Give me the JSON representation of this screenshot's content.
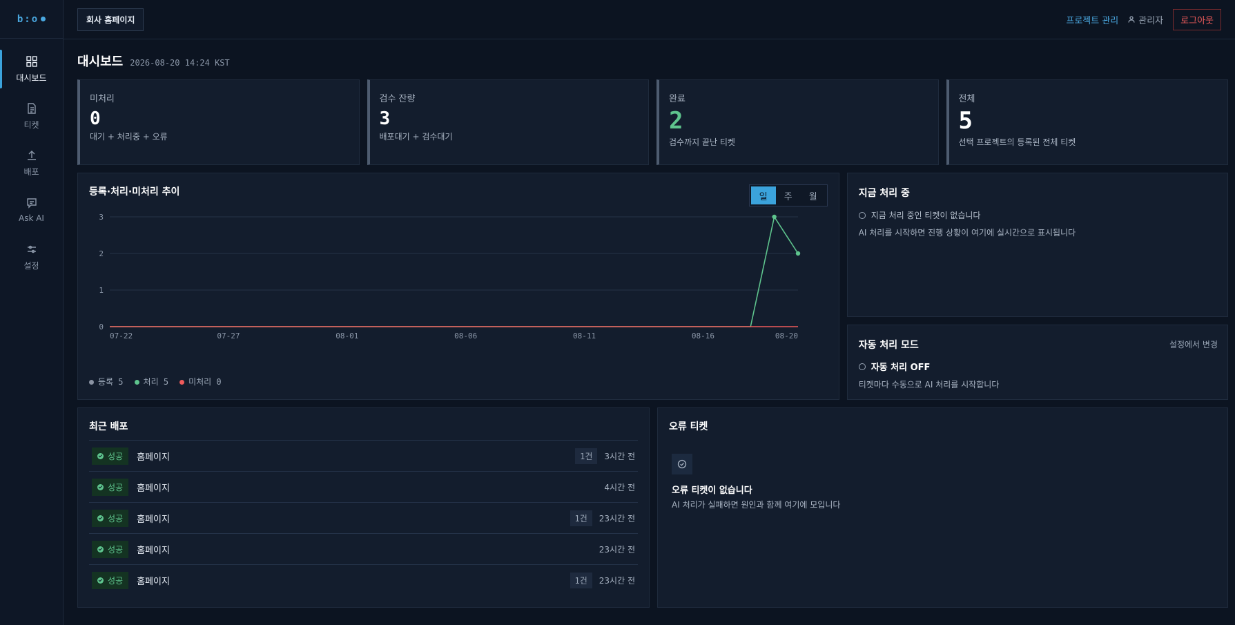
{
  "sidebar": {
    "logo": "b:o",
    "items": [
      {
        "label": "대시보드",
        "icon": "dashboard-icon"
      },
      {
        "label": "티켓",
        "icon": "document-icon"
      },
      {
        "label": "배포",
        "icon": "upload-icon"
      },
      {
        "label": "Ask AI",
        "icon": "chat-icon"
      },
      {
        "label": "설정",
        "icon": "sliders-icon"
      }
    ]
  },
  "topbar": {
    "project": "회사 홈페이지",
    "manage_projects": "프로젝트 관리",
    "user": "관리자",
    "logout": "로그아웃"
  },
  "page": {
    "title": "대시보드",
    "timestamp": "2026-08-20 14:24 KST"
  },
  "stats": [
    {
      "label": "미처리",
      "value": "0",
      "sub": "대기 + 처리중 + 오류"
    },
    {
      "label": "검수 잔량",
      "value": "3",
      "sub": "배포대기 + 검수대기"
    },
    {
      "label": "완료",
      "value": "2",
      "sub": "검수까지 끝난 티켓"
    },
    {
      "label": "전체",
      "value": "5",
      "sub": "선택 프로젝트의 등록된 전체 티켓"
    }
  ],
  "chart": {
    "title": "등록·처리·미처리 추이",
    "periods": [
      "일",
      "주",
      "월"
    ],
    "active_period": "일",
    "legend": [
      {
        "label": "등록 5",
        "color": "#8a93a3"
      },
      {
        "label": "처리 5",
        "color": "#5ec48d"
      },
      {
        "label": "미처리 0",
        "color": "#ef5b5b"
      }
    ]
  },
  "chart_data": {
    "type": "line",
    "x": [
      "07-22",
      "07-23",
      "07-24",
      "07-25",
      "07-26",
      "07-27",
      "07-28",
      "07-29",
      "07-30",
      "07-31",
      "08-01",
      "08-02",
      "08-03",
      "08-04",
      "08-05",
      "08-06",
      "08-07",
      "08-08",
      "08-09",
      "08-10",
      "08-11",
      "08-12",
      "08-13",
      "08-14",
      "08-15",
      "08-16",
      "08-17",
      "08-18",
      "08-19",
      "08-20"
    ],
    "xticks": [
      "07-22",
      "07-27",
      "08-01",
      "08-06",
      "08-11",
      "08-16",
      "08-20"
    ],
    "yticks": [
      0,
      1,
      2,
      3
    ],
    "ylim": [
      0,
      3
    ],
    "grid": true,
    "series": [
      {
        "name": "처리",
        "color": "#5ec48d",
        "values": [
          0,
          0,
          0,
          0,
          0,
          0,
          0,
          0,
          0,
          0,
          0,
          0,
          0,
          0,
          0,
          0,
          0,
          0,
          0,
          0,
          0,
          0,
          0,
          0,
          0,
          0,
          0,
          0,
          3,
          2
        ]
      },
      {
        "name": "미처리",
        "color": "#ef5b5b",
        "values": [
          0,
          0,
          0,
          0,
          0,
          0,
          0,
          0,
          0,
          0,
          0,
          0,
          0,
          0,
          0,
          0,
          0,
          0,
          0,
          0,
          0,
          0,
          0,
          0,
          0,
          0,
          0,
          0,
          0,
          0
        ]
      }
    ]
  },
  "now": {
    "title": "지금 처리 중",
    "empty": "지금 처리 중인 티켓이 없습니다",
    "desc": "AI 처리를 시작하면 진행 상황이 여기에 실시간으로 표시됩니다"
  },
  "auto": {
    "title": "자동 처리 모드",
    "link": "설정에서 변경",
    "status": "자동 처리 OFF",
    "desc": "티켓마다 수동으로 AI 처리를 시작합니다"
  },
  "deploys": {
    "title": "최근 배포",
    "rows": [
      {
        "status": "성공",
        "name": "홈페이지",
        "count": "1건",
        "ago": "3시간 전"
      },
      {
        "status": "성공",
        "name": "홈페이지",
        "count": "",
        "ago": "4시간 전"
      },
      {
        "status": "성공",
        "name": "홈페이지",
        "count": "1건",
        "ago": "23시간 전"
      },
      {
        "status": "성공",
        "name": "홈페이지",
        "count": "",
        "ago": "23시간 전"
      },
      {
        "status": "성공",
        "name": "홈페이지",
        "count": "1건",
        "ago": "23시간 전"
      }
    ]
  },
  "errors": {
    "title": "오류 티켓",
    "empty_title": "오류 티켓이 없습니다",
    "empty_desc": "AI 처리가 실패하면 원인과 함께 여기에 모입니다"
  }
}
